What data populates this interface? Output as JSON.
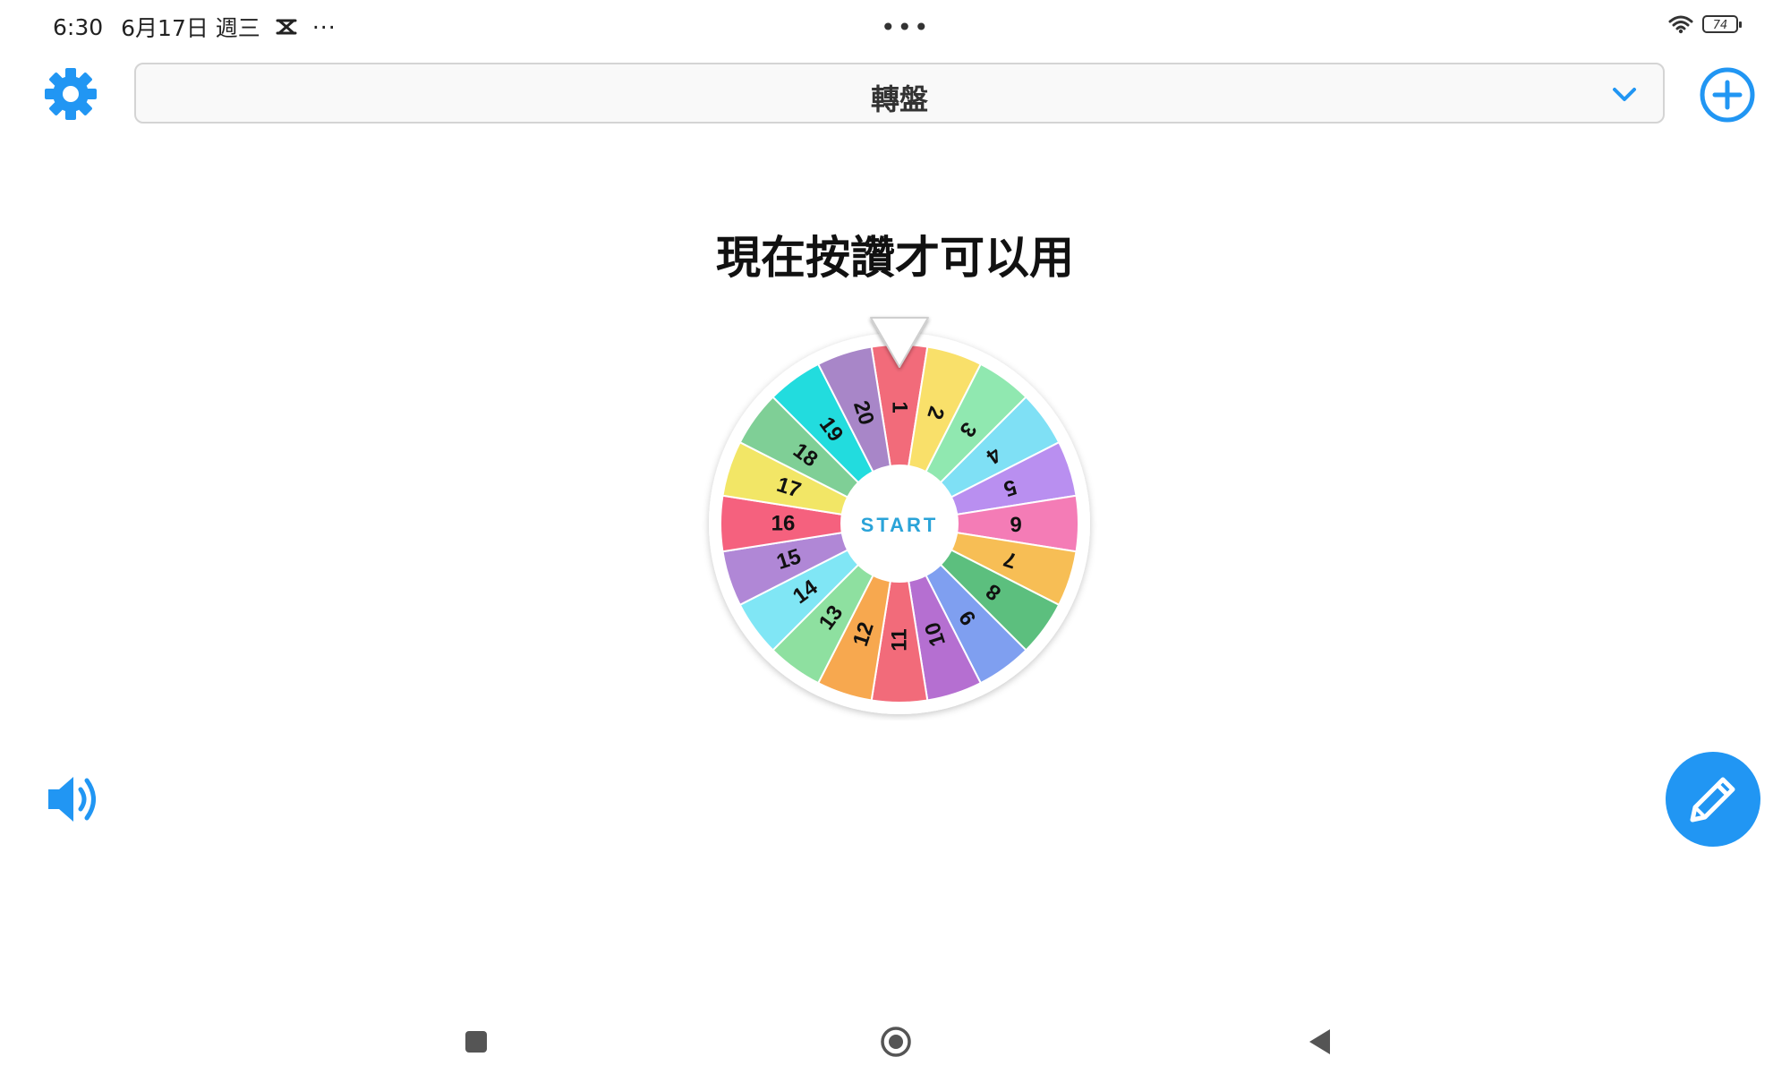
{
  "status_bar": {
    "time": "6:30",
    "date": "6月17日 週三",
    "more": "···",
    "center_dots": "•••",
    "battery": "74"
  },
  "toolbar": {
    "wheel_name": "轉盤"
  },
  "main": {
    "title": "現在按讚才可以用",
    "start_label": "START",
    "segments": [
      {
        "label": "1",
        "color": "#f26b7a"
      },
      {
        "label": "2",
        "color": "#f9e06a"
      },
      {
        "label": "3",
        "color": "#90e8b0"
      },
      {
        "label": "4",
        "color": "#7fe0f5"
      },
      {
        "label": "5",
        "color": "#b98ff0"
      },
      {
        "label": "6",
        "color": "#f47cb6"
      },
      {
        "label": "7",
        "color": "#f7be55"
      },
      {
        "label": "8",
        "color": "#5cbf7e"
      },
      {
        "label": "9",
        "color": "#7f9ff0"
      },
      {
        "label": "10",
        "color": "#b56fd1"
      },
      {
        "label": "11",
        "color": "#f26b7a"
      },
      {
        "label": "12",
        "color": "#f7a84f"
      },
      {
        "label": "13",
        "color": "#8ee0a0"
      },
      {
        "label": "14",
        "color": "#80e6f5"
      },
      {
        "label": "15",
        "color": "#b087d6"
      },
      {
        "label": "16",
        "color": "#f5617e"
      },
      {
        "label": "17",
        "color": "#f2e666"
      },
      {
        "label": "18",
        "color": "#7fcf96"
      },
      {
        "label": "19",
        "color": "#22dcde"
      },
      {
        "label": "20",
        "color": "#a886c8"
      }
    ]
  },
  "colors": {
    "accent": "#2196f3",
    "start_text": "#2aa3d8"
  },
  "icons": {
    "settings": "gear-icon",
    "dropdown": "chevron-down-icon",
    "add": "plus-circle-icon",
    "sound": "speaker-icon",
    "edit": "pencil-icon",
    "nav_recents": "square-icon",
    "nav_home": "circle-icon",
    "nav_back": "triangle-back-icon"
  }
}
